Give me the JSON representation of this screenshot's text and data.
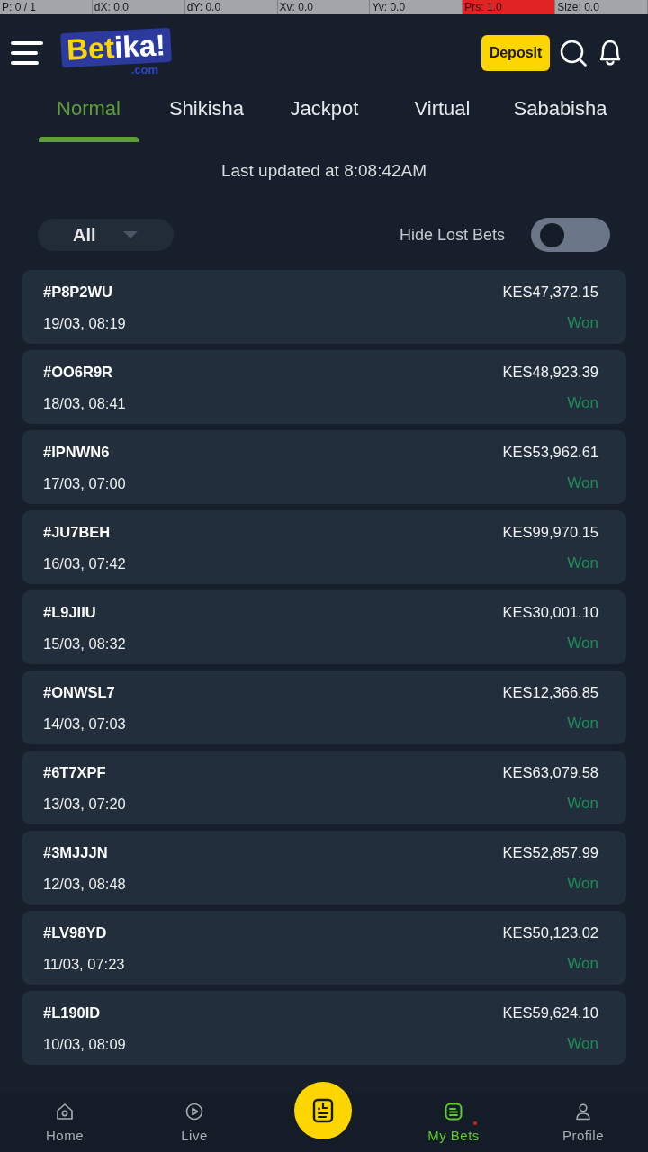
{
  "pointer_overlay": [
    {
      "text": "P: 0 / 1",
      "color": "#a2a5aa"
    },
    {
      "text": "dX: 0.0",
      "color": "#a2a5aa"
    },
    {
      "text": "dY: 0.0",
      "color": "#a2a5aa"
    },
    {
      "text": "Xv: 0.0",
      "color": "#a2a5aa"
    },
    {
      "text": "Yv: 0.0",
      "color": "#a2a5aa"
    },
    {
      "text": "Prs: 1.0",
      "color": "#e02424"
    },
    {
      "text": "Size: 0.0",
      "color": "#a2a5aa"
    }
  ],
  "header": {
    "logo": {
      "word_1": "Bet",
      "word_2": "ika!",
      "domain": ".com"
    },
    "deposit_button": "Deposit"
  },
  "tabs": [
    {
      "label": "Normal",
      "selected": true
    },
    {
      "label": "Shikisha",
      "selected": false
    },
    {
      "label": "Jackpot",
      "selected": false
    },
    {
      "label": "Virtual",
      "selected": false
    },
    {
      "label": "Sababisha",
      "selected": false
    }
  ],
  "last_updated": "Last updated at 8:08:42AM",
  "filters": {
    "dropdown": {
      "value": "All"
    },
    "hide_lost": {
      "label": "Hide Lost Bets",
      "on": false
    }
  },
  "bets": [
    {
      "id": "#P8P2WU",
      "date": "19/03, 08:19",
      "amount": "KES47,372.15",
      "status": "Won"
    },
    {
      "id": "#OO6R9R",
      "date": "18/03, 08:41",
      "amount": "KES48,923.39",
      "status": "Won"
    },
    {
      "id": "#IPNWN6",
      "date": "17/03, 07:00",
      "amount": "KES53,962.61",
      "status": "Won"
    },
    {
      "id": "#JU7BEH",
      "date": "16/03, 07:42",
      "amount": "KES99,970.15",
      "status": "Won"
    },
    {
      "id": "#L9JIIU",
      "date": "15/03, 08:32",
      "amount": "KES30,001.10",
      "status": "Won"
    },
    {
      "id": "#ONWSL7",
      "date": "14/03, 07:03",
      "amount": "KES12,366.85",
      "status": "Won"
    },
    {
      "id": "#6T7XPF",
      "date": "13/03, 07:20",
      "amount": "KES63,079.58",
      "status": "Won"
    },
    {
      "id": "#3MJJJN",
      "date": "12/03, 08:48",
      "amount": "KES52,857.99",
      "status": "Won"
    },
    {
      "id": "#LV98YD",
      "date": "11/03, 07:23",
      "amount": "KES50,123.02",
      "status": "Won"
    },
    {
      "id": "#L190ID",
      "date": "10/03, 08:09",
      "amount": "KES59,624.10",
      "status": "Won"
    }
  ],
  "bottom_nav": [
    {
      "kind": "tab",
      "label": "Home",
      "selected": false,
      "dot": false
    },
    {
      "kind": "tab",
      "label": "Live",
      "selected": false,
      "dot": false
    },
    {
      "kind": "center",
      "selected": false
    },
    {
      "kind": "tab",
      "label": "My Bets",
      "selected": true,
      "dot": true
    },
    {
      "kind": "tab",
      "label": "Profile",
      "selected": false,
      "dot": false
    }
  ]
}
